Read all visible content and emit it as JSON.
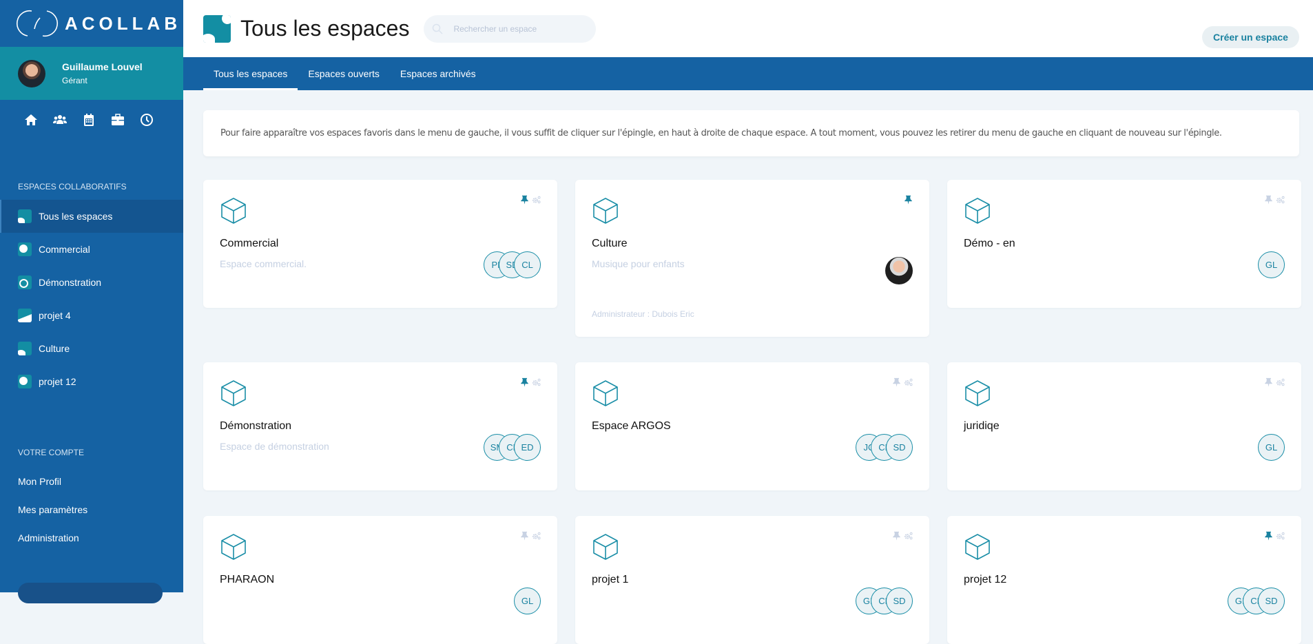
{
  "app": {
    "brand": "ACOLLAB"
  },
  "user": {
    "name": "Guillaume Louvel",
    "role": "Gérant"
  },
  "quick_icons": [
    "home-icon",
    "users-icon",
    "calendar-icon",
    "briefcase-icon",
    "clock-icon"
  ],
  "sidebar": {
    "spaces_title": "ESPACES COLLABORATIFS",
    "spaces": [
      {
        "label": "Tous les espaces",
        "active": true
      },
      {
        "label": "Commercial"
      },
      {
        "label": "Démonstration"
      },
      {
        "label": "projet 4"
      },
      {
        "label": "Culture"
      },
      {
        "label": "projet 12"
      }
    ],
    "account_title": "VOTRE COMPTE",
    "account": [
      {
        "label": "Mon Profil"
      },
      {
        "label": "Mes paramètres"
      },
      {
        "label": "Administration"
      }
    ]
  },
  "header": {
    "title": "Tous les espaces",
    "search_placeholder": "Rechercher un espace",
    "search_value": "",
    "create_label": "Créer un espace"
  },
  "tabs": [
    {
      "label": "Tous les espaces",
      "active": true
    },
    {
      "label": "Espaces ouverts"
    },
    {
      "label": "Espaces archivés"
    }
  ],
  "info_text": "Pour faire apparaître vos espaces favoris dans le menu de gauche, il vous suffit de cliquer sur l'épingle, en haut à droite de chaque espace. A tout moment, vous pouvez les retirer du menu de gauche en cliquant de nouveau sur l'épingle.",
  "colors": {
    "primary": "#1562a3",
    "accent": "#138ea3",
    "pin_active": "#1a82a0",
    "pin_inactive": "#c8d2e3"
  },
  "cards": [
    {
      "title": "Commercial",
      "description": "Espace commercial.",
      "pinned": true,
      "settings": true,
      "members": [
        "PL",
        "SD",
        "CL"
      ]
    },
    {
      "title": "Culture",
      "description": "Musique pour enfants",
      "pinned": true,
      "settings": false,
      "members": [
        "photo"
      ],
      "admin": "Administrateur : Dubois Eric"
    },
    {
      "title": "Démo - en",
      "description": "",
      "pinned": false,
      "settings": true,
      "members": [
        "GL"
      ]
    },
    {
      "title": "Démonstration",
      "description": "Espace de démonstration",
      "pinned": true,
      "settings": true,
      "members": [
        "SM",
        "CL",
        "ED"
      ]
    },
    {
      "title": "Espace ARGOS",
      "description": "",
      "pinned": false,
      "settings": true,
      "members": [
        "JC",
        "CL",
        "SD"
      ]
    },
    {
      "title": "juridiqe",
      "description": "",
      "pinned": false,
      "settings": true,
      "members": [
        "GL"
      ]
    },
    {
      "title": "PHARAON",
      "description": "",
      "pinned": false,
      "settings": true,
      "members": [
        "GL"
      ]
    },
    {
      "title": "projet 1",
      "description": "",
      "pinned": false,
      "settings": true,
      "members": [
        "GL",
        "CL",
        "SD"
      ]
    },
    {
      "title": "projet 12",
      "description": "",
      "pinned": true,
      "settings": true,
      "members": [
        "GL",
        "CL",
        "SD"
      ]
    }
  ]
}
